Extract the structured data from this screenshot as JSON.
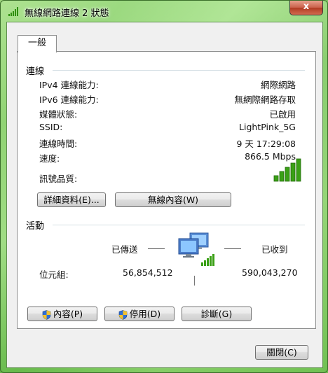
{
  "window": {
    "title": "無線網路連線 2 狀態",
    "close_label": "x"
  },
  "tabs": [
    {
      "label": "一般"
    }
  ],
  "connection": {
    "heading": "連線",
    "rows": [
      {
        "label": "IPv4 連線能力:",
        "value": "網際網路"
      },
      {
        "label": "IPv6 連線能力:",
        "value": "無網際網路存取"
      },
      {
        "label": "媒體狀態:",
        "value": "已啟用"
      },
      {
        "label": "SSID:",
        "value": "LightPink_5G"
      },
      {
        "label": "連線時間:",
        "value": "9 天 17:29:08"
      },
      {
        "label": "速度:",
        "value": "866.5 Mbps"
      }
    ],
    "signal_label": "訊號品質:",
    "signal_bars": 5,
    "details_button": "詳細資料(E)...",
    "wireless_props_button": "無線內容(W)"
  },
  "activity": {
    "heading": "活動",
    "sent_label": "已傳送",
    "received_label": "已收到",
    "bytes_label": "位元組:",
    "bytes_sent": "56,854,512",
    "bytes_received": "590,043,270"
  },
  "actions": {
    "properties_button": "內容(P)",
    "disable_button": "停用(D)",
    "diagnose_button": "診斷(G)"
  },
  "footer": {
    "close_button": "關閉(C)"
  },
  "colors": {
    "signal_green": "#3aa016",
    "window_frame": "#79c45a",
    "close_red": "#c9604a"
  }
}
